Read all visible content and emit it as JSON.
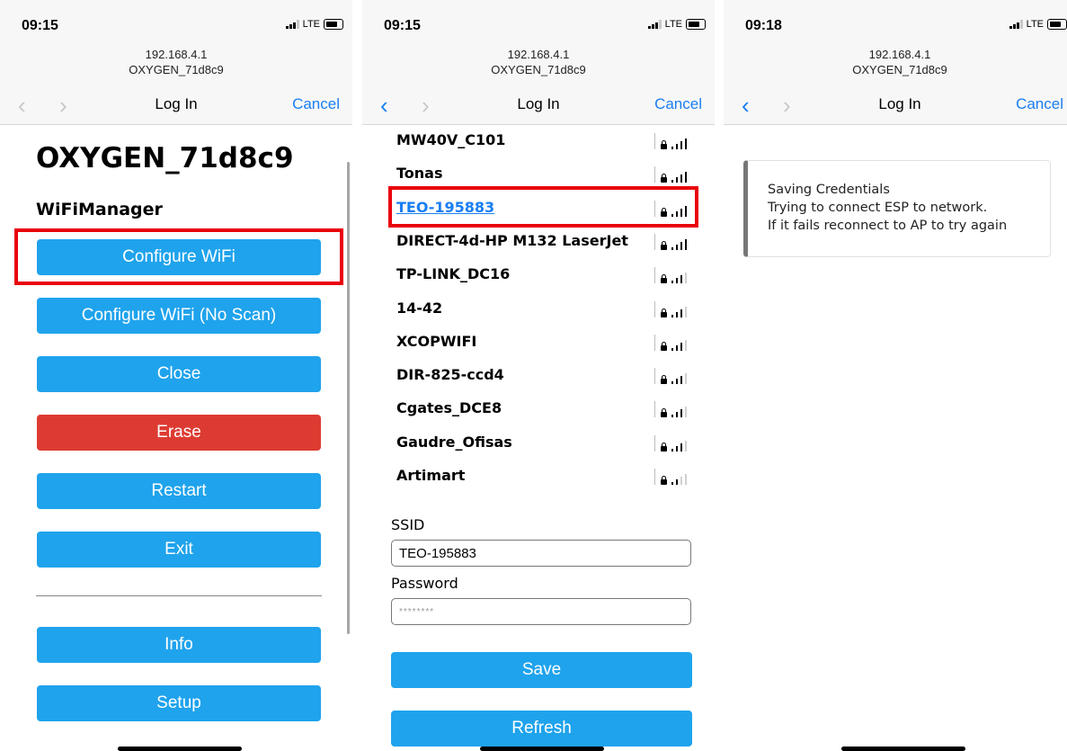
{
  "status": {
    "time1": "09:15",
    "time2": "09:15",
    "time3": "09:18",
    "network": "LTE"
  },
  "browser": {
    "host": "192.168.4.1",
    "ssid": "OXYGEN_71d8c9",
    "title": "Log In",
    "cancel": "Cancel"
  },
  "menu": {
    "heading": "OXYGEN_71d8c9",
    "subheading": "WiFiManager",
    "buttons": [
      "Configure WiFi",
      "Configure WiFi (No Scan)",
      "Close",
      "Erase",
      "Restart",
      "Exit",
      "Info",
      "Setup"
    ]
  },
  "networks": [
    {
      "name": "MW40V_C101",
      "signal": 4
    },
    {
      "name": "Tonas",
      "signal": 4
    },
    {
      "name": "TEO-195883",
      "signal": 4
    },
    {
      "name": "DIRECT-4d-HP M132 LaserJet",
      "signal": 4
    },
    {
      "name": "TP-LINK_DC16",
      "signal": 3
    },
    {
      "name": "14-42",
      "signal": 3
    },
    {
      "name": "XCOPWIFI",
      "signal": 3
    },
    {
      "name": "DIR-825-ccd4",
      "signal": 3
    },
    {
      "name": "Cgates_DCE8",
      "signal": 3
    },
    {
      "name": "Gaudre_Ofisas",
      "signal": 3
    },
    {
      "name": "Artimart",
      "signal": 2
    }
  ],
  "form": {
    "ssid_label": "SSID",
    "ssid_value": "TEO-195883",
    "password_label": "Password",
    "password_value": "********",
    "save": "Save",
    "refresh": "Refresh"
  },
  "result": {
    "lines": [
      "Saving Credentials",
      "Trying to connect ESP to network.",
      "If it fails reconnect to AP to try again"
    ]
  },
  "colors": {
    "button": "#1fa3ec",
    "erase": "#dd3b32",
    "highlight": "#e9000b",
    "link": "#1a7ef1"
  }
}
